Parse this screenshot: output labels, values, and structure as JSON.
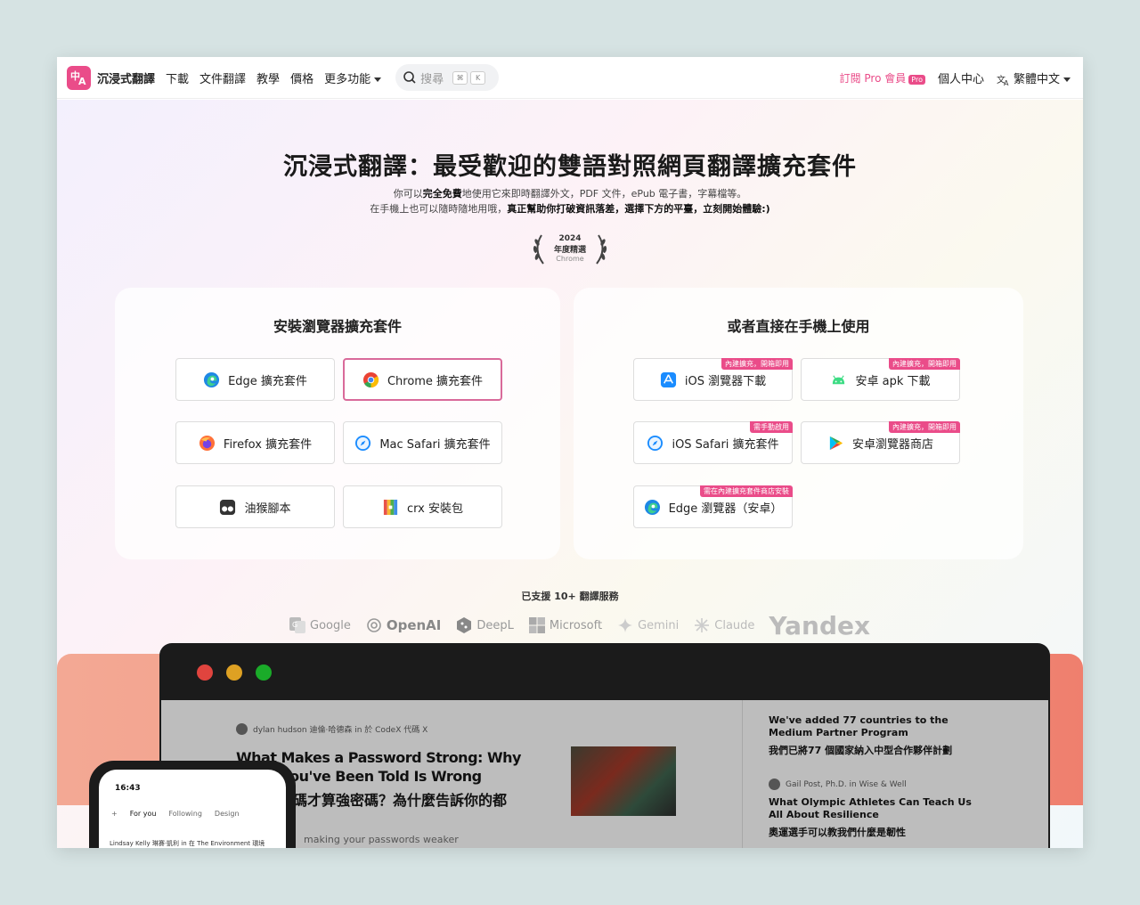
{
  "nav": {
    "logo_top": "中",
    "logo_bottom": "A",
    "brand": "沉浸式翻譯",
    "links": [
      "下載",
      "文件翻譯",
      "教學",
      "價格"
    ],
    "more": "更多功能",
    "search_placeholder": "搜尋",
    "kbd_1": "⌘",
    "kbd_2": "K",
    "subscribe": "訂閱 Pro 會員",
    "pro_badge": "Pro",
    "account": "個人中心",
    "language": "繁體中文"
  },
  "hero": {
    "title": "沉浸式翻譯：最受歡迎的雙語對照網頁翻譯擴充套件",
    "sub1_pre": "你可以",
    "sub1_bold": "完全免費",
    "sub1_post": "地使用它來即時翻譯外文，PDF 文件，ePub 電子書，字幕檔等。",
    "sub2_pre": "在手機上也可以隨時隨地用哦，",
    "sub2_bold": "真正幫助你打破資訊落差，選擇下方的平臺，立刻開始體驗:)",
    "award_year": "2024",
    "award_title": "年度精選",
    "award_source": "Chrome"
  },
  "browser_panel": {
    "title": "安裝瀏覽器擴充套件",
    "buttons": [
      "Edge 擴充套件",
      "Chrome 擴充套件",
      "Firefox 擴充套件",
      "Mac Safari 擴充套件",
      "油猴腳本",
      "crx 安裝包"
    ]
  },
  "mobile_panel": {
    "title": "或者直接在手機上使用",
    "buttons": [
      "iOS 瀏覽器下載",
      "安卓 apk 下載",
      "iOS Safari 擴充套件",
      "安卓瀏覽器商店",
      "Edge 瀏覽器（安卓）"
    ],
    "tags": [
      "內建擴充，開箱即用",
      "內建擴充，開箱即用",
      "需手動啟用",
      "內建擴充，開箱即用",
      "需在內建擴充套件商店安裝"
    ]
  },
  "services": {
    "label": "已支援 10+ 翻譯服務",
    "providers": [
      "Google",
      "OpenAI",
      "DeepL",
      "Microsoft",
      "Gemini",
      "Claude",
      "Yandex"
    ]
  },
  "preview": {
    "meta": "dylan hudson 迪倫·哈德森 in 於 CodeX 代碼 X",
    "title": "What Makes a Password Strong: Why What You've Been Told Is Wrong",
    "title_zh": "什麼使密碼才算強密碼？為什麼告訴你的都",
    "snippet": "making your passwords weaker",
    "side1": "We've added 77 countries to the Medium Partner Program",
    "side1_zh": "我們已將77 個國家納入中型合作夥伴計劃",
    "side_meta": "Gail Post, Ph.D. in Wise & Well",
    "side2": "What Olympic Athletes Can Teach Us All About Resilience",
    "side2_zh": "奧運選手可以教我們什麼是韌性",
    "phone_time": "16:43",
    "phone_tabs": [
      "+",
      "For you",
      "Following",
      "Design"
    ],
    "phone_item": "Lindsay Kelly 琳賽·凱利 in 在 The Environment 環境"
  },
  "colors": {
    "brand": "#ea4c89",
    "blob": "#f29d85"
  }
}
